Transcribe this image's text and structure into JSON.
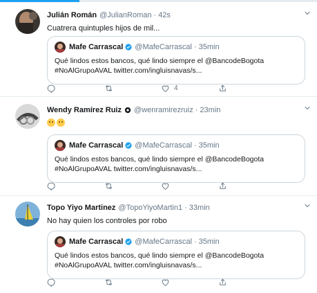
{
  "colors": {
    "accent": "#1da1f2",
    "text": "#14171a",
    "muted": "#657786",
    "border": "#e6ecf0"
  },
  "loading_bar": {
    "progress": 0.25
  },
  "tweets": [
    {
      "name": "Julián Román",
      "handle": "@JulianRoman",
      "separator": "·",
      "time": "42s",
      "text": "Cuatrera quintuples hijos de mil...",
      "avatar_icon": "portrait-photo",
      "quote": {
        "name": "Mafe Carrascal",
        "handle": "@MafeCarrascal",
        "separator": "·",
        "time": "35min",
        "text": "Qué lindos estos bancos, qué lindo siempre el @BancodeBogota #NoAlGrupoAVAL twitter.com/ingluisnavas/s..."
      },
      "actions": {
        "reply": "",
        "retweet": "",
        "like": "4",
        "share": ""
      }
    },
    {
      "name": "Wendy Ramírez Ruiz",
      "handle": "@wenramirezruiz",
      "separator": "·",
      "time": "23min",
      "text": "",
      "emojis": [
        "slightly-frowning-face",
        "slightly-frowning-face"
      ],
      "avatar_icon": "rings-photo",
      "quote": {
        "name": "Mafe Carrascal",
        "handle": "@MafeCarrascal",
        "separator": "·",
        "time": "35min",
        "text": "Qué lindos estos bancos, qué lindo siempre el @BancodeBogota #NoAlGrupoAVAL twitter.com/ingluisnavas/s..."
      },
      "actions": {
        "reply": "",
        "retweet": "",
        "like": "",
        "share": ""
      }
    },
    {
      "name": "Topo Yiyo Martinez",
      "handle": "@TopoYiyoMartin1",
      "separator": "·",
      "time": "33min",
      "text": "No hay quien los controles  por robo",
      "avatar_icon": "windsurf-photo",
      "quote": {
        "name": "Mafe Carrascal",
        "handle": "@MafeCarrascal",
        "separator": "·",
        "time": "35min",
        "text": "Qué lindos estos bancos, qué lindo siempre el @BancodeBogota #NoAlGrupoAVAL twitter.com/ingluisnavas/s..."
      },
      "actions": {
        "reply": "",
        "retweet": "",
        "like": "",
        "share": ""
      }
    }
  ]
}
